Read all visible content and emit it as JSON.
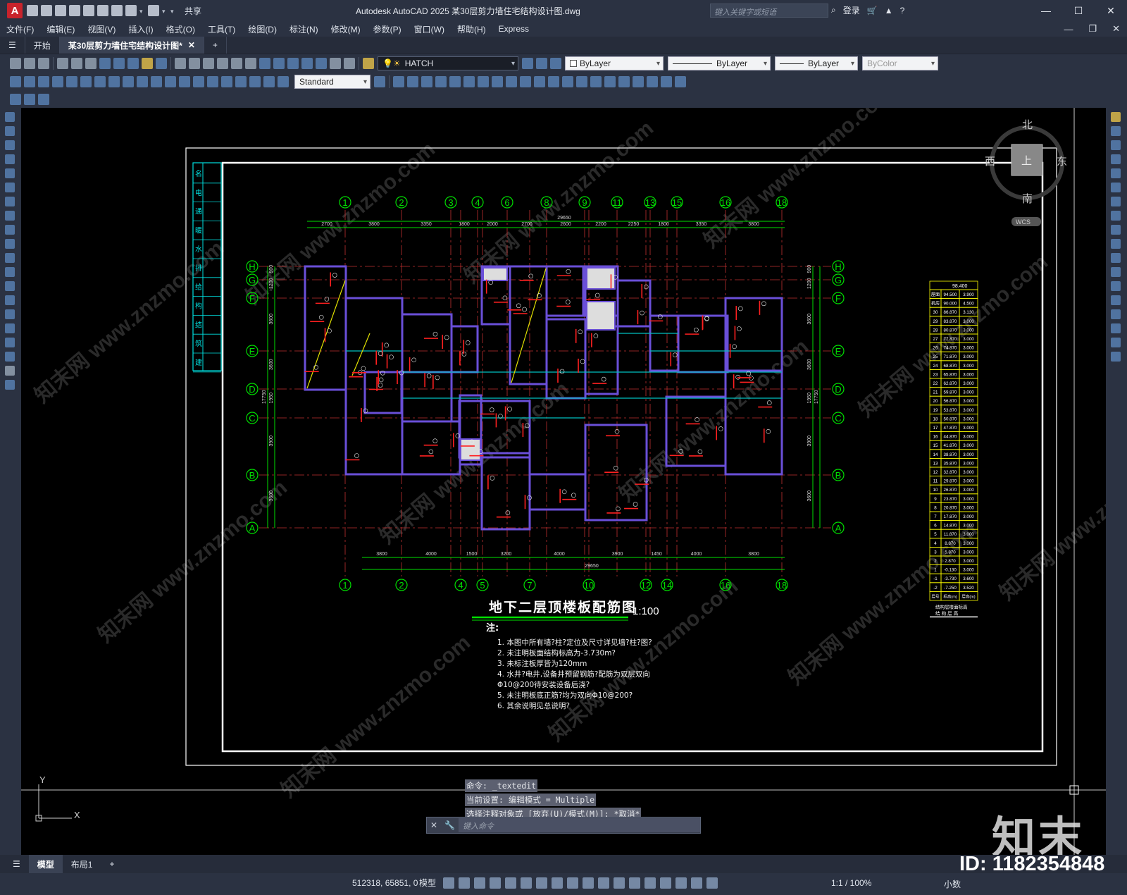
{
  "app": {
    "title": "Autodesk AutoCAD 2025    某30层剪力墙住宅结构设计图.dwg",
    "logo": "A",
    "share": "共享",
    "search_placeholder": "键入关键字或短语",
    "login": "登录"
  },
  "menu": [
    "文件(F)",
    "编辑(E)",
    "视图(V)",
    "插入(I)",
    "格式(O)",
    "工具(T)",
    "绘图(D)",
    "标注(N)",
    "修改(M)",
    "参数(P)",
    "窗口(W)",
    "帮助(H)",
    "Express"
  ],
  "tabs": [
    "开始",
    "某30层剪力墙住宅结构设计图*"
  ],
  "toolbar": {
    "layer": "HATCH",
    "color": "ByLayer",
    "linetype": "ByLayer",
    "lineweight": "ByLayer",
    "plotstyle": "ByColor",
    "textstyle": "Standard"
  },
  "viewcube": {
    "north": "北",
    "south": "南",
    "east": "东",
    "west": "西",
    "top": "上",
    "wcs": "WCS"
  },
  "drawing": {
    "title": "地下二层顶楼板配筋图",
    "scale": "1:100",
    "notes_title": "注:",
    "notes": [
      "1.  本图中所有墙?柱?定位及尺寸详见墙?柱?图?",
      "2.  未注明板面结构标高为-3.730m?",
      "3.  未标注板厚皆为120mm",
      "4.  水井?电井,设备井预留钢筋?配筋为双层双向",
      "     Φ10@200待安装设备后浇?",
      "5.  未注明板底正筋?均为双向Φ10@200?",
      "6.  其余说明见总说明?"
    ],
    "top_axes": [
      "1",
      "2",
      "3",
      "4",
      "6",
      "8",
      "9",
      "11",
      "13",
      "15",
      "16",
      "18"
    ],
    "bottom_axes": [
      "1",
      "2",
      "4",
      "5",
      "7",
      "10",
      "12",
      "14",
      "16",
      "18"
    ],
    "side_axes": [
      "H",
      "G",
      "F",
      "E",
      "D",
      "C",
      "B",
      "A"
    ],
    "top_dims": [
      "2700",
      "3800",
      "3350",
      "1800",
      "2000",
      "2700",
      "2600",
      "2200",
      "2250",
      "1800",
      "3350",
      "3800"
    ],
    "top_total": "29650",
    "bottom_dims": [
      "3800",
      "4000",
      "1500",
      "3200",
      "4000",
      "3900",
      "1450",
      "4000",
      "3800"
    ],
    "bottom_total": "29650",
    "left_dims": [
      "900",
      "1200",
      "3600",
      "3600",
      "1950",
      "3900",
      "3600"
    ],
    "left_total": "17750",
    "titleblock_chars": [
      "名",
      "电",
      "通",
      "暖",
      "水",
      "排",
      "给",
      "构",
      "结",
      "筑",
      "建"
    ],
    "floor_table_top": "98.400",
    "floor_table": [
      [
        "屋面",
        "94.500",
        "3.900"
      ],
      [
        "机房",
        "90.000",
        "4.500"
      ],
      [
        "30",
        "86.870",
        "3.130"
      ],
      [
        "29",
        "83.870",
        "3.000"
      ],
      [
        "28",
        "80.870",
        "3.000"
      ],
      [
        "27",
        "77.870",
        "3.000"
      ],
      [
        "26",
        "74.870",
        "3.000"
      ],
      [
        "25",
        "71.870",
        "3.000"
      ],
      [
        "24",
        "68.870",
        "3.000"
      ],
      [
        "23",
        "65.870",
        "3.000"
      ],
      [
        "22",
        "62.870",
        "3.000"
      ],
      [
        "21",
        "59.870",
        "3.000"
      ],
      [
        "20",
        "56.870",
        "3.000"
      ],
      [
        "19",
        "53.870",
        "3.000"
      ],
      [
        "18",
        "50.870",
        "3.000"
      ],
      [
        "17",
        "47.870",
        "3.000"
      ],
      [
        "16",
        "44.870",
        "3.000"
      ],
      [
        "15",
        "41.870",
        "3.000"
      ],
      [
        "14",
        "38.870",
        "3.000"
      ],
      [
        "13",
        "35.870",
        "3.000"
      ],
      [
        "12",
        "32.870",
        "3.000"
      ],
      [
        "11",
        "29.870",
        "3.000"
      ],
      [
        "10",
        "26.870",
        "3.000"
      ],
      [
        "9",
        "23.870",
        "3.000"
      ],
      [
        "8",
        "20.870",
        "3.000"
      ],
      [
        "7",
        "17.870",
        "3.000"
      ],
      [
        "6",
        "14.870",
        "3.000"
      ],
      [
        "5",
        "11.870",
        "3.000"
      ],
      [
        "4",
        "8.870",
        "3.000"
      ],
      [
        "3",
        "5.870",
        "3.000"
      ],
      [
        "2",
        "2.870",
        "3.000"
      ],
      [
        "1",
        "-0.130",
        "3.000"
      ],
      [
        "-1",
        "-3.730",
        "3.600"
      ],
      [
        "-2",
        "-7.250",
        "3.520"
      ]
    ],
    "floor_table_header": [
      "层号",
      "标高(m)",
      "层高(m)"
    ],
    "floor_table_caption": "结构层楼面标高",
    "floor_table_caption2": "结 构 层 高",
    "ucs_x": "X",
    "ucs_y": "Y"
  },
  "command": {
    "history": [
      "命令: _textedit",
      "当前设置: 编辑模式 = Multiple",
      "选择注释对象或 [放弃(U)/模式(M)]: *取消*"
    ],
    "placeholder": "键入命令"
  },
  "layouts": [
    "模型",
    "布局1"
  ],
  "status": {
    "coords": "512318, 65851, 0",
    "model": "模型",
    "scale": "1:1 / 100%",
    "units": "小数"
  },
  "watermark": {
    "logo": "知末",
    "id": "ID: 1182354848",
    "site": "知末网 www.znzmo.com"
  },
  "colors": {
    "wall": "#6a4fd8",
    "axis": "#00e000",
    "rebar": "#ff2020",
    "canvas": "#000000",
    "frame": "#ffffff",
    "table": "#ffff00"
  }
}
